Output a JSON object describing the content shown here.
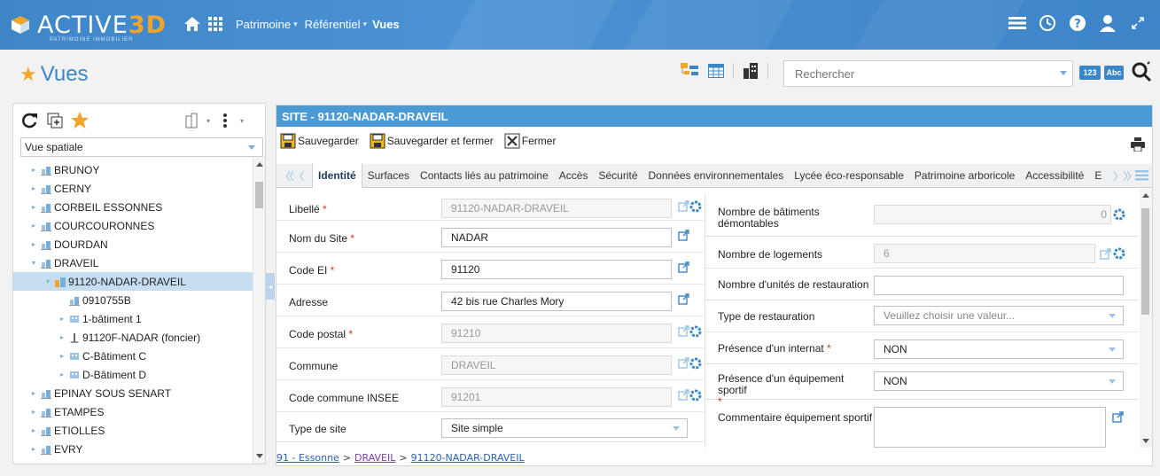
{
  "brand": {
    "name_prefix": "ACTIVE",
    "name_suffix": "3D",
    "tagline": "PATRIMOINE IMMOBILIER"
  },
  "topnav": {
    "items": [
      "Patrimoine",
      "Référentiel"
    ],
    "current": "Vues",
    "separator": "▾"
  },
  "page": {
    "title": "Vues"
  },
  "search": {
    "placeholder": "Rechercher",
    "btn_num": "123",
    "btn_abc": "Abc"
  },
  "left": {
    "view_select": "Vue spatiale",
    "tree": [
      {
        "label": "BRUNOY",
        "level": 0,
        "twist": "▸",
        "icon": "building-icon"
      },
      {
        "label": "CERNY",
        "level": 0,
        "twist": "▸",
        "icon": "building-icon"
      },
      {
        "label": "CORBEIL ESSONNES",
        "level": 0,
        "twist": "▸",
        "icon": "building-icon"
      },
      {
        "label": "COURCOURONNES",
        "level": 0,
        "twist": "▸",
        "icon": "building-icon"
      },
      {
        "label": "DOURDAN",
        "level": 0,
        "twist": "▸",
        "icon": "building-icon"
      },
      {
        "label": "DRAVEIL",
        "level": 0,
        "twist": "▾",
        "icon": "building-icon"
      },
      {
        "label": "91120-NADAR-DRAVEIL",
        "level": 1,
        "twist": "▾",
        "icon": "site-icon",
        "selected": true
      },
      {
        "label": "0910755B",
        "level": 2,
        "twist": "",
        "icon": "building-icon"
      },
      {
        "label": "1-bâtiment 1",
        "level": 2,
        "twist": "▸",
        "icon": "block-icon"
      },
      {
        "label": "91120F-NADAR (foncier)",
        "level": 2,
        "twist": "▸",
        "icon": "land-icon"
      },
      {
        "label": "C-Bâtiment C",
        "level": 2,
        "twist": "▸",
        "icon": "block-icon"
      },
      {
        "label": "D-Bâtiment D",
        "level": 2,
        "twist": "▸",
        "icon": "block-icon"
      },
      {
        "label": "EPINAY SOUS SENART",
        "level": 0,
        "twist": "▸",
        "icon": "building-icon"
      },
      {
        "label": "ETAMPES",
        "level": 0,
        "twist": "▸",
        "icon": "building-icon"
      },
      {
        "label": "ETIOLLES",
        "level": 0,
        "twist": "▸",
        "icon": "building-icon"
      },
      {
        "label": "EVRY",
        "level": 0,
        "twist": "▸",
        "icon": "building-icon"
      }
    ]
  },
  "main": {
    "header": "SITE - 91120-NADAR-DRAVEIL",
    "actions": {
      "save": "Sauvegarder",
      "save_close": "Sauvegarder et fermer",
      "close": "Fermer"
    },
    "tabs": [
      "Identité",
      "Surfaces",
      "Contacts liés au patrimoine",
      "Accès",
      "Sécurité",
      "Données environnementales",
      "Lycée éco-responsable",
      "Patrimoine arboricole",
      "Accessibilité",
      "E"
    ],
    "left_fields": [
      {
        "label": "Libellé",
        "required": true,
        "value": "91120-NADAR-DRAVEIL",
        "readonly": true,
        "gear": true
      },
      {
        "label": "Nom du Site",
        "required": true,
        "value": "NADAR",
        "readonly": false,
        "gear": false
      },
      {
        "label": "Code EI",
        "required": true,
        "value": "91120",
        "readonly": false,
        "gear": false
      },
      {
        "label": "Adresse",
        "required": false,
        "value": "42 bis rue Charles Mory",
        "readonly": false,
        "gear": false
      },
      {
        "label": "Code postal",
        "required": true,
        "value": "91210",
        "readonly": true,
        "gear": true
      },
      {
        "label": "Commune",
        "required": false,
        "value": "DRAVEIL",
        "readonly": true,
        "gear": true
      },
      {
        "label": "Code commune INSEE",
        "required": false,
        "value": "91201",
        "readonly": true,
        "gear": true
      },
      {
        "label": "Type de site",
        "required": false,
        "value": "Site simple",
        "select": true
      }
    ],
    "right_fields": {
      "batiments_label": "Nombre de bâtiments démontables",
      "batiments_value": "0",
      "logements_label": "Nombre de logements",
      "logements_value": "6",
      "restauration_label": "Nombre d'unités de restauration",
      "restauration_value": "",
      "type_resto_label": "Type de restauration",
      "type_resto_placeholder": "Veuillez choisir une valeur...",
      "internat_label": "Présence d'un internat",
      "internat_value": "NON",
      "sportif_label": "Présence d'un équipement sportif",
      "sportif_value": "NON",
      "commentaire_label": "Commentaire équipement sportif"
    },
    "breadcrumb": {
      "first": "91 - Essonne",
      "second": "DRAVEIL",
      "third": "91120-NADAR-DRAVEIL",
      "sep": ">"
    }
  },
  "colors": {
    "brand_blue": "#3b86c8",
    "accent_orange": "#f2a52a",
    "required_red": "#d9342b",
    "selected_row": "#c6def2"
  }
}
